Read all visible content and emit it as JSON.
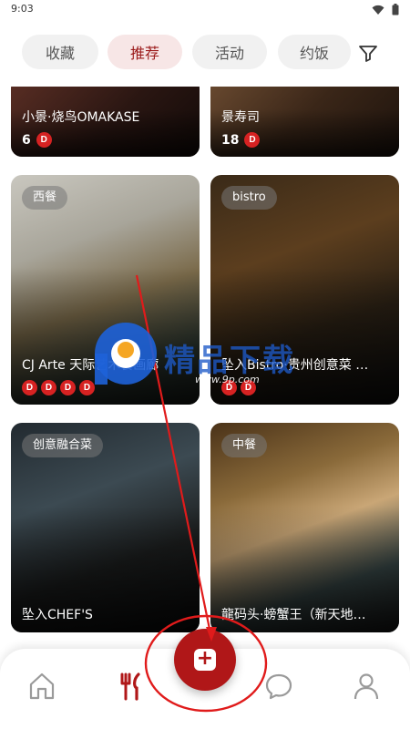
{
  "status": {
    "time": "9:03",
    "wifi_icon": "wifi-icon",
    "battery_icon": "battery-icon"
  },
  "tabs": [
    {
      "label": "收藏",
      "active": false
    },
    {
      "label": "推荐",
      "active": true
    },
    {
      "label": "活动",
      "active": false
    },
    {
      "label": "约饭",
      "active": false
    }
  ],
  "filter_icon": "filter-icon",
  "cards": [
    {
      "name": "小景·烧鸟OMAKASE",
      "count": "6",
      "badges": [
        "D"
      ]
    },
    {
      "name": "景寿司",
      "count": "18",
      "badges": [
        "D"
      ]
    },
    {
      "tag": "西餐",
      "name": "CJ Arte 天际艺术餐画廊",
      "badges": [
        "D",
        "D",
        "D",
        "D"
      ]
    },
    {
      "tag": "bistro",
      "name": "坠入Bistro·贵州创意菜 …",
      "badges": [
        "D",
        "D"
      ]
    },
    {
      "tag": "创意融合菜",
      "name": "坠入CHEF'S"
    },
    {
      "tag": "中餐",
      "name": "龍码头·螃蟹王（新天地…"
    }
  ],
  "nav": {
    "home_icon": "home-icon",
    "dining_icon": "fork-knife-icon",
    "add_icon": "plus-icon",
    "add_symbol": "+",
    "chat_icon": "chat-bubble-icon",
    "profile_icon": "person-icon"
  },
  "watermark": {
    "text": "精品下载",
    "url": "www.9p.com"
  },
  "colors": {
    "accent": "#b01718",
    "active_tab_bg": "#f7e6e6",
    "active_tab_text": "#9b1b1b",
    "badge": "#d62222",
    "annotation": "#e01b1b"
  }
}
